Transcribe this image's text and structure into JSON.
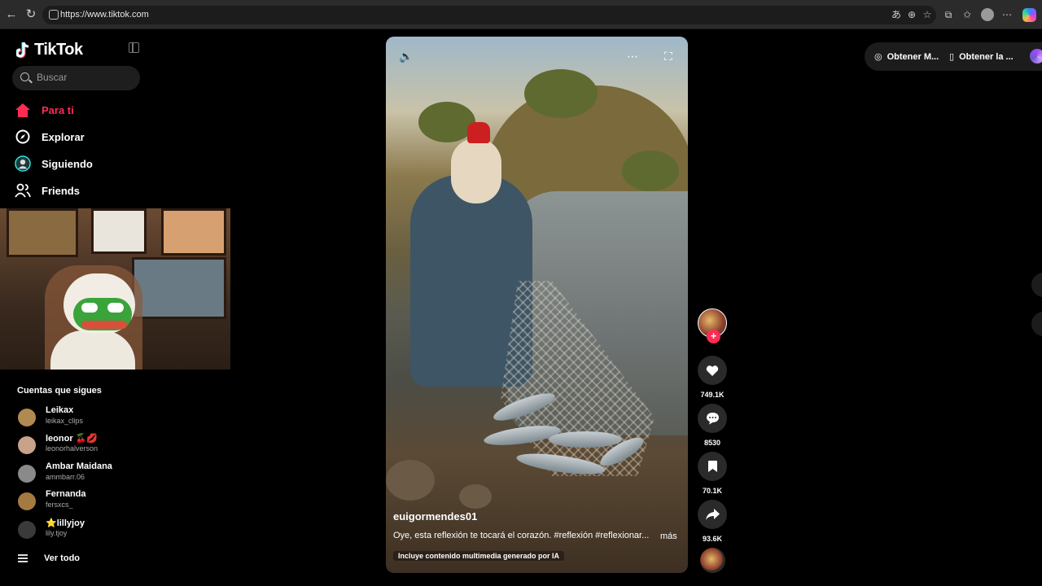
{
  "browser": {
    "url": "https://www.tiktok.com"
  },
  "app": {
    "logo": "TikTok",
    "accent": "#fe2c55"
  },
  "search": {
    "placeholder": "Buscar"
  },
  "nav": {
    "items": [
      {
        "label": "Para ti",
        "icon": "home-icon",
        "active": true
      },
      {
        "label": "Explorar",
        "icon": "compass-icon",
        "active": false
      },
      {
        "label": "Siguiendo",
        "icon": "following-icon",
        "active": false
      },
      {
        "label": "Friends",
        "icon": "friends-icon",
        "active": false
      }
    ]
  },
  "following": {
    "title": "Cuentas que sigues",
    "accounts": [
      {
        "name": "Leikax",
        "handle": "leikax_clips",
        "color": "#b08a50"
      },
      {
        "name": "leonor 🍒💋",
        "handle": "leonorhalverson",
        "color": "#c9a28a"
      },
      {
        "name": "Ambar Maidana",
        "handle": "ammbarr.06",
        "color": "#8a8a8a"
      },
      {
        "name": "Fernanda",
        "handle": "fersxcs_",
        "color": "#a57a40"
      },
      {
        "name": "⭐lillyjoy",
        "handle": "lily.tjoy",
        "color": "#3a3a3a"
      }
    ],
    "see_all": "Ver todo"
  },
  "video": {
    "author": "euigormendes01",
    "description": "Oye, esta reflexión te tocará el corazón. #reflexión #reflexionar...",
    "more": "más",
    "ai_label": "Incluye contenido multimedia generado por IA"
  },
  "actions": {
    "likes": "749.1K",
    "comments": "8530",
    "saves": "70.1K",
    "shares": "93.6K"
  },
  "top_right": {
    "get_app_1": "Obtener M...",
    "get_app_2": "Obtener la ..."
  }
}
